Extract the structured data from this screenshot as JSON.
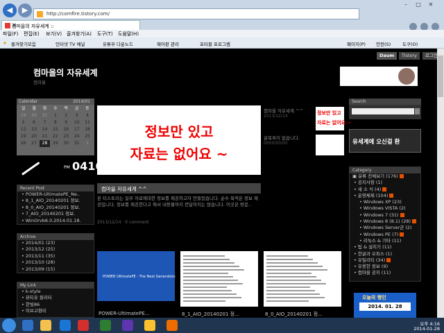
{
  "browser": {
    "url": "http://comfire.tistory.com/",
    "tab_title": "컴마을의 자유세계 ::",
    "menu": [
      "파일(F)",
      "편집(E)",
      "보기(V)",
      "즐겨찾기(A)",
      "도구(T)",
      "도움말(H)"
    ],
    "favorites": [
      "즐겨찾기모음",
      "인터넷 TV 채널",
      "유튜부 다운노드",
      "제어판 관리",
      "포터블 프로그램"
    ],
    "toolbar_right": [
      "페이지(P)",
      "안전(S)",
      "도구(O)"
    ]
  },
  "daumbar": [
    "Daum",
    "Tistory",
    "로그인"
  ],
  "blog": {
    "title": "컴마을의 자유세계",
    "subtitle": "컴마을"
  },
  "calendar": {
    "label": "Calendar",
    "month": "2014/01",
    "days_header": [
      "일",
      "월",
      "화",
      "수",
      "목",
      "금",
      "토"
    ],
    "rows": [
      [
        "29",
        "30",
        "31",
        "1",
        "2",
        "3",
        "4"
      ],
      [
        "5",
        "6",
        "7",
        "8",
        "9",
        "10",
        "11"
      ],
      [
        "12",
        "13",
        "14",
        "15",
        "16",
        "17",
        "18"
      ],
      [
        "19",
        "20",
        "21",
        "22",
        "23",
        "24",
        "25"
      ],
      [
        "26",
        "27",
        "28",
        "29",
        "30",
        "31",
        "1"
      ]
    ]
  },
  "clock": {
    "ampm": "PM",
    "time": "0416"
  },
  "recent_post": {
    "title": "Recent Post",
    "items": [
      "POWER-UltimatePE_Ne..",
      "8_1_AIO_20140201 정보.",
      "8_0_AIO_20140201 정보.",
      "7_AIO_20140201 정보.",
      "WinOrvb6.0.2014.01.18."
    ]
  },
  "archive": {
    "title": "Archive",
    "items": [
      "2014/01 (23)",
      "2013/12 (25)",
      "2013/11 (35)",
      "2013/10 (28)",
      "2013/09 (15)"
    ]
  },
  "mylink": {
    "title": "My Link",
    "items": [
      "k-style",
      "뷰티유 블리터",
      "한빛86",
      "이브고향리"
    ]
  },
  "main_post": {
    "image_line1": "정보만 있고",
    "image_line2": "자료는 없어요 ~",
    "title": "컴마을 자유세계 ^^",
    "desc": "본 티스토리는 일부 자료에대한 정보를 제공하고자 만들었습니다. 순수 목적은 정보 제공입니다. 정보를 제공한다고 해서 내용물까지 전달하지는 않습니다. 이곳은 방문..",
    "meta": "2013/12/14 · 0 comment"
  },
  "side_post": {
    "title": "컴마을 자유세계 ^^",
    "date": "2013/12/14",
    "none_text": "글목록이 없습니다.",
    "date2": "0000/00/00"
  },
  "thumbs": [
    {
      "caption": "POWER-UltimatePE...",
      "image_text": "POWER UltimatePE - The Next Generation"
    },
    {
      "caption": "8_1_AIO_20140201 정..."
    },
    {
      "caption": "8_0_AIO_20140201 정..."
    }
  ],
  "search": {
    "title": "Search"
  },
  "welcome": {
    "text": "유세계에 오신걸 환"
  },
  "category": {
    "title": "Category",
    "items": [
      {
        "text": "분류 전체보기 (176)",
        "level": 0,
        "new": true
      },
      {
        "text": "공지사항 (1)",
        "level": 1,
        "new": false
      },
      {
        "text": "새 소 식 (4)",
        "level": 1,
        "new": true
      },
      {
        "text": "운영체제 (104)",
        "level": 1,
        "new": true
      },
      {
        "text": "Windows XP (23)",
        "level": 2,
        "new": false
      },
      {
        "text": "Windows VISTA (2)",
        "level": 2,
        "new": false
      },
      {
        "text": "Windows 7 (31)",
        "level": 2,
        "new": true
      },
      {
        "text": "Windows 8 (8.1) (28)",
        "level": 2,
        "new": true
      },
      {
        "text": "Windows Server군 (2)",
        "level": 2,
        "new": false
      },
      {
        "text": "Windows PE (7)",
        "level": 2,
        "new": true
      },
      {
        "text": "리눅스 & 기타 (11)",
        "level": 2,
        "new": false
      },
      {
        "text": "팁 & 설치기 (11)",
        "level": 1,
        "new": false
      },
      {
        "text": "한글과 오피스 (1)",
        "level": 1,
        "new": false
      },
      {
        "text": "유틸리티 (34)",
        "level": 1,
        "new": true
      },
      {
        "text": "유용한 정보 (9)",
        "level": 1,
        "new": false
      },
      {
        "text": "컴마을 공지 (11)",
        "level": 1,
        "new": false
      }
    ]
  },
  "visit": {
    "title": "오늘의 행인",
    "date": "2014. 01. 28"
  },
  "taskbar": {
    "time": "오후 4:16",
    "date": "2014-01-28"
  }
}
